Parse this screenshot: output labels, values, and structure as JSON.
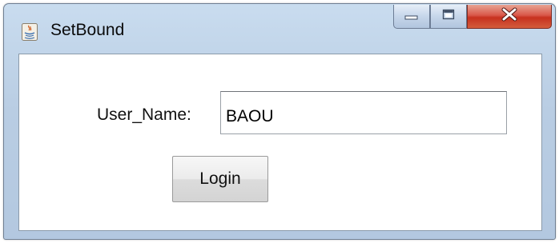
{
  "window": {
    "title": "SetBound"
  },
  "titlebar_controls": {
    "minimize_icon": "minimize-icon",
    "maximize_icon": "maximize-icon",
    "close_icon": "close-icon",
    "close_color": "#c7311f"
  },
  "form": {
    "username_label": "User_Name:",
    "username_value": "BAOU",
    "login_label": "Login"
  }
}
